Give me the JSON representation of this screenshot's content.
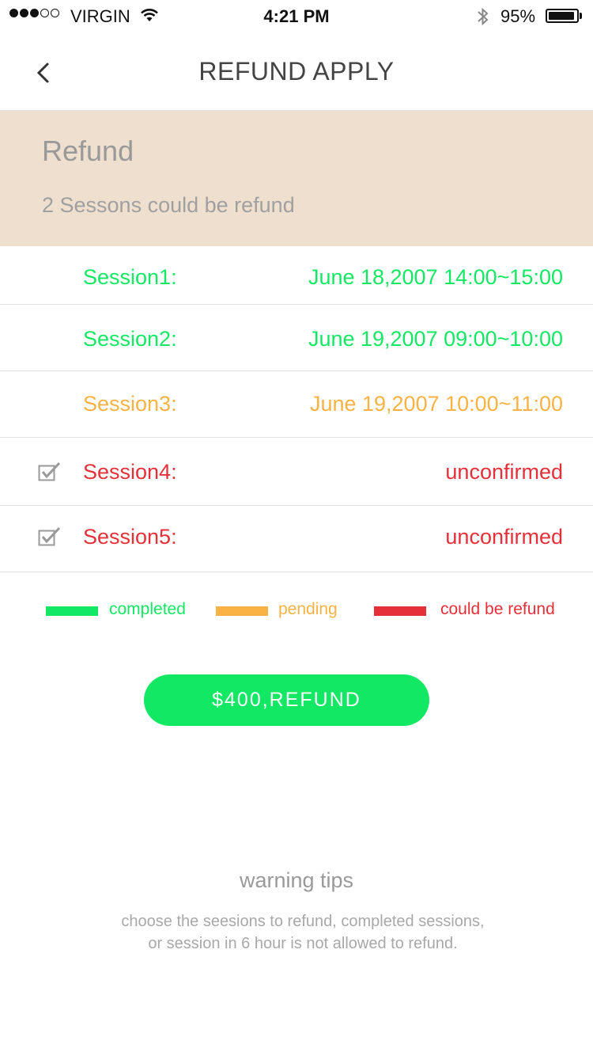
{
  "status": {
    "carrier": "VIRGIN",
    "time": "4:21 PM",
    "battery": "95%",
    "battery_level": 0.95
  },
  "nav": {
    "title": "REFUND APPLY"
  },
  "refund": {
    "title": "Refund",
    "subtitle": "2 Sessons could be refund"
  },
  "sessions": [
    {
      "label": "Session1:",
      "value": "June 18,2007 14:00~15:00",
      "status": "completed",
      "checkbox": false
    },
    {
      "label": "Session2:",
      "value": "June 19,2007 09:00~10:00",
      "status": "completed",
      "checkbox": false
    },
    {
      "label": "Session3:",
      "value": "June 19,2007 10:00~11:00",
      "status": "pending",
      "checkbox": false
    },
    {
      "label": "Session4:",
      "value": "unconfirmed",
      "status": "could be refund",
      "checkbox": true
    },
    {
      "label": "Session5:",
      "value": "unconfirmed",
      "status": "could be refund",
      "checkbox": true
    }
  ],
  "legend": [
    {
      "label": "completed",
      "color": "#12e864"
    },
    {
      "label": "pending",
      "color": "#f9b243"
    },
    {
      "label": "could be refund",
      "color": "#e5303a"
    }
  ],
  "colors": {
    "completed": "#12e864",
    "pending": "#f9b243",
    "refund": "#e5303a"
  },
  "button": {
    "label": "$400,REFUND"
  },
  "tips": {
    "title": "warning tips",
    "line1": "choose the seesions to refund, completed sessions,",
    "line2": "or session in 6 hour is not allowed to refund."
  }
}
